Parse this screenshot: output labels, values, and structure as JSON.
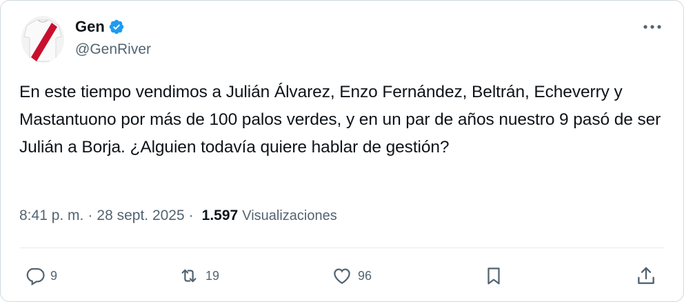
{
  "author": {
    "display_name": "Gen",
    "handle": "@GenRiver",
    "verified": true,
    "avatar_icon": "river-plate-jersey-avatar"
  },
  "tweet": {
    "text": "En este tiempo vendimos a Julián Álvarez, Enzo Fernández, Beltrán, Echeverry y Mastantuono por más de 100 palos verdes, y en un par de años nuestro 9 pasó de ser Julián a Borja. ¿Alguien todavía quiere hablar de gestión?",
    "time": "8:41 p. m.",
    "date": "28 sept. 2025",
    "views_count": "1.597",
    "views_label": "Visualizaciones"
  },
  "actions": {
    "replies": "9",
    "reposts": "19",
    "likes": "96"
  },
  "colors": {
    "text": "#0f1419",
    "secondary": "#536471",
    "verified_blue": "#1d9bf0",
    "border": "#cfd9de"
  }
}
